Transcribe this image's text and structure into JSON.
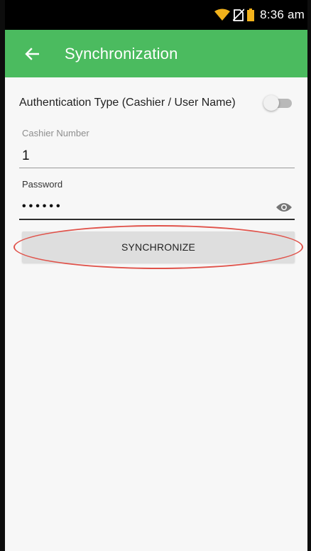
{
  "status_bar": {
    "time": "8:36 am",
    "icons": [
      "wifi-icon",
      "no-sim-icon",
      "battery-icon"
    ]
  },
  "app_bar": {
    "back_icon": "arrow-left-icon",
    "title": "Synchronization",
    "color": "#4bbb5f"
  },
  "auth": {
    "label": "Authentication Type (Cashier / User Name)",
    "toggle_on": false
  },
  "cashier": {
    "label": "Cashier Number",
    "value": "1"
  },
  "password": {
    "label": "Password",
    "masked_value": "••••••",
    "toggle_icon": "eye-icon"
  },
  "sync_button": {
    "label": "SYNCHRONIZE"
  },
  "annotation": {
    "color": "#e0524a"
  }
}
